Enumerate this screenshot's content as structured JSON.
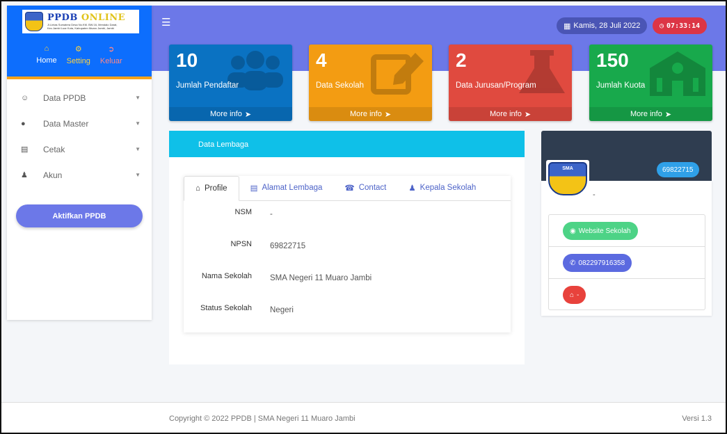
{
  "brand": {
    "title_main": "PPDB",
    "title_accent": "ONLINE",
    "subtitle_line1": "Jl.Lintas Sumatera Desa No.KM. BW.16, Mendalo Darat,",
    "subtitle_line2": "Kec.Jambi Luar Kota, Kabupaten Muaro Jambi, Jambi"
  },
  "topmenu": {
    "home": "Home",
    "setting": "Setting",
    "logout": "Keluar"
  },
  "nav": {
    "items": [
      {
        "label": "Data PPDB"
      },
      {
        "label": "Data Master"
      },
      {
        "label": "Cetak"
      },
      {
        "label": "Akun"
      }
    ],
    "activate_button": "Aktifkan PPDB"
  },
  "header": {
    "date": "Kamis, 28 Juli 2022",
    "time": "07:33:14"
  },
  "stats": [
    {
      "value": "10",
      "label": "Jumlah Pendaftar",
      "more": "More info",
      "color": "#0a72c2"
    },
    {
      "value": "4",
      "label": "Data Sekolah",
      "more": "More info",
      "color": "#f39c12"
    },
    {
      "value": "2",
      "label": "Data Jurusan/Program",
      "more": "More info",
      "color": "#e04a3f"
    },
    {
      "value": "150",
      "label": "Jumlah Kuota",
      "more": "More info",
      "color": "#18a94c"
    }
  ],
  "panel": {
    "title": "Data Lembaga",
    "tabs": [
      {
        "label": "Profile",
        "icon": "home-icon"
      },
      {
        "label": "Alamat Lembaga",
        "icon": "address-card-icon"
      },
      {
        "label": "Contact",
        "icon": "contact-icon"
      },
      {
        "label": "Kepala Sekolah",
        "icon": "user-icon"
      }
    ],
    "fields": [
      {
        "key": "NSM",
        "value": "-"
      },
      {
        "key": "NPSN",
        "value": "69822715"
      },
      {
        "key": "Nama Sekolah",
        "value": "SMA Negeri 11 Muaro Jambi"
      },
      {
        "key": "Status Sekolah",
        "value": "Negeri"
      }
    ]
  },
  "profile": {
    "npsn_badge": "69822715",
    "logo_text": "SMA",
    "name": "-",
    "website_label": "Website Sekolah",
    "phone": "082297916358",
    "home_label": "-"
  },
  "footer": {
    "copyright": "Copyright © 2022 PPDB | SMA Negeri 11 Muaro Jambi",
    "version": "Versi 1.3"
  }
}
